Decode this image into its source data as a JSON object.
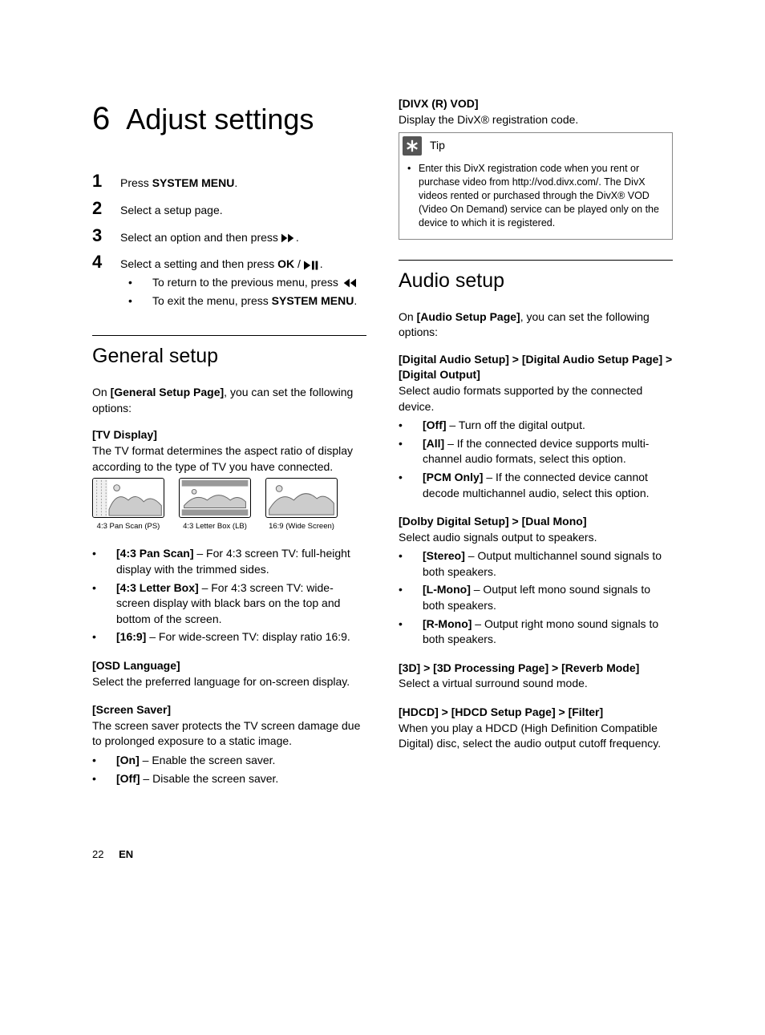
{
  "chapter": {
    "num": "6",
    "title": "Adjust settings"
  },
  "steps": {
    "s1": {
      "n": "1",
      "pre": "Press ",
      "bold": "SYSTEM MENU",
      "post": "."
    },
    "s2": {
      "n": "2",
      "text": "Select a setup page."
    },
    "s3": {
      "n": "3",
      "pre": "Select an option and then press ",
      "post": "."
    },
    "s4": {
      "n": "4",
      "pre": "Select a setting and then press ",
      "bold": "OK",
      "mid": " / ",
      "post": "."
    },
    "sub1": {
      "pre": "To return to the previous menu, press "
    },
    "sub2": {
      "pre": "To exit the menu, press ",
      "bold": "SYSTEM MENU",
      "post": "."
    }
  },
  "general": {
    "heading": "General setup",
    "intro_pre": "On ",
    "intro_bold": "[General Setup Page]",
    "intro_post": ", you can set the following options:",
    "tv": {
      "title": "[TV Display]",
      "desc": "The TV format determines the aspect ratio of display according to the type of TV you have connected.",
      "c1": "4:3 Pan Scan (PS)",
      "c2": "4:3 Letter Box (LB)",
      "c3": "16:9 (Wide Screen)",
      "b1": {
        "bold": "[4:3 Pan Scan]",
        "text": " – For 4:3 screen TV: full-height display with the trimmed sides."
      },
      "b2": {
        "bold": "[4:3 Letter Box]",
        "text": " – For 4:3 screen TV: wide-screen display with black bars on the top and bottom of the screen."
      },
      "b3": {
        "bold": "[16:9]",
        "text": " – For wide-screen TV: display ratio 16:9."
      }
    },
    "osd": {
      "title": "[OSD Language]",
      "desc": "Select the preferred language for on-screen display."
    },
    "ss": {
      "title": "[Screen Saver]",
      "desc": "The screen saver protects the TV screen damage due to prolonged exposure to a static image.",
      "b1": {
        "bold": "[On]",
        "text": " – Enable the screen saver."
      },
      "b2": {
        "bold": "[Off]",
        "text": " – Disable the screen saver."
      }
    }
  },
  "divx": {
    "title": "[DIVX (R) VOD]",
    "desc": "Display the DivX® registration code.",
    "tip_label": "Tip",
    "tip_text": "Enter this DivX registration code when you rent or purchase video from http://vod.divx.com/. The DivX videos rented or purchased through the DivX® VOD (Video On Demand) service can be played only on the device to which it is registered."
  },
  "audio": {
    "heading": "Audio setup",
    "intro_pre": "On ",
    "intro_bold": "[Audio Setup Page]",
    "intro_post": ", you can set the following options:",
    "das": {
      "title": "[Digital Audio Setup] > [Digital Audio Setup Page] > [Digital Output]",
      "desc": "Select audio formats supported by the connected device.",
      "b1": {
        "bold": "[Off]",
        "text": " – Turn off the digital output."
      },
      "b2": {
        "bold": "[All]",
        "text": " – If the connected device supports multi-channel audio formats, select this option."
      },
      "b3": {
        "bold": "[PCM Only]",
        "text": " – If the connected device cannot decode multichannel audio, select this option."
      }
    },
    "dolby": {
      "title": "[Dolby Digital Setup] > [Dual Mono]",
      "desc": "Select audio signals output to speakers.",
      "b1": {
        "bold": "[Stereo]",
        "text": " – Output multichannel sound signals to both speakers."
      },
      "b2": {
        "bold": "[L-Mono]",
        "text": " – Output left mono sound signals to both speakers."
      },
      "b3": {
        "bold": "[R-Mono]",
        "text": " – Output right mono sound signals to both speakers."
      }
    },
    "threeD": {
      "title": "[3D] > [3D Processing Page] > [Reverb Mode]",
      "desc": "Select a virtual surround sound mode."
    },
    "hdcd": {
      "title": "[HDCD] > [HDCD Setup Page] > [Filter]",
      "desc": "When you play a HDCD (High Definition Compatible Digital) disc, select the audio output cutoff frequency."
    }
  },
  "footer": {
    "page": "22",
    "lang": "EN"
  }
}
